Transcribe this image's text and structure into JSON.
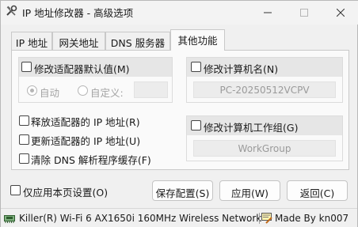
{
  "window": {
    "title": "IP 地址修改器 - 高级选项"
  },
  "tabs": [
    {
      "label": "IP 地址"
    },
    {
      "label": "网关地址"
    },
    {
      "label": "DNS 服务器"
    },
    {
      "label": "其他功能"
    }
  ],
  "adapter_defaults": {
    "checkbox_label": "修改适配器默认值(M)",
    "auto_label": "自动",
    "custom_label": "自定义:",
    "custom_value": ""
  },
  "computer_name": {
    "checkbox_label": "修改计算机名(N)",
    "value": "PC-20250512VCPV"
  },
  "workgroup": {
    "checkbox_label": "修改计算机工作组(G)",
    "value": "WorkGroup"
  },
  "actions": {
    "release_label": "释放适配器的 IP 地址(R)",
    "renew_label": "更新适配器的 IP 地址(U)",
    "flush_dns_label": "清除 DNS 解析程序缓存(F)"
  },
  "footer": {
    "apply_page_only_label": "仅应用本页设置(O)",
    "save_label": "保存配置(S)",
    "apply_label": "应用(W)",
    "back_label": "返回(C)"
  },
  "statusbar": {
    "adapter": "Killer(R) Wi-Fi 6 AX1650i 160MHz Wireless Network",
    "author": "Made By kn007"
  }
}
